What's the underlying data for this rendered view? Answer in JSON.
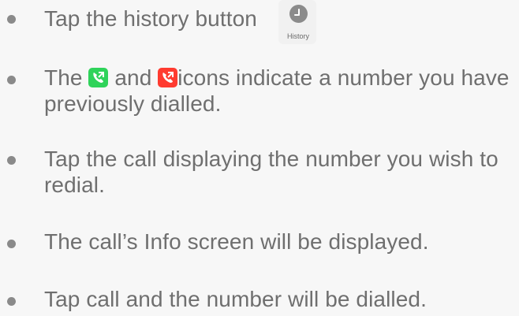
{
  "steps": [
    {
      "text_before": "Tap the history button",
      "icon": "history-button-icon",
      "icon_label": "History"
    },
    {
      "text_before": "The",
      "icon_a": "outgoing-call-green-icon",
      "text_mid": "and",
      "icon_b": "outgoing-call-red-icon",
      "text_after": "icons indicate a number you have previously dialled."
    },
    {
      "text": "Tap the call displaying the number you wish to redial."
    },
    {
      "text": "The call’s Info screen will be displayed."
    },
    {
      "text": "Tap call and the number will be dialled."
    }
  ],
  "colors": {
    "background": "#f7f7f7",
    "text": "#6f6f6f",
    "bullet": "#8a8a8a",
    "green_icon": "#2fd35a",
    "red_icon": "#ff3b30"
  }
}
